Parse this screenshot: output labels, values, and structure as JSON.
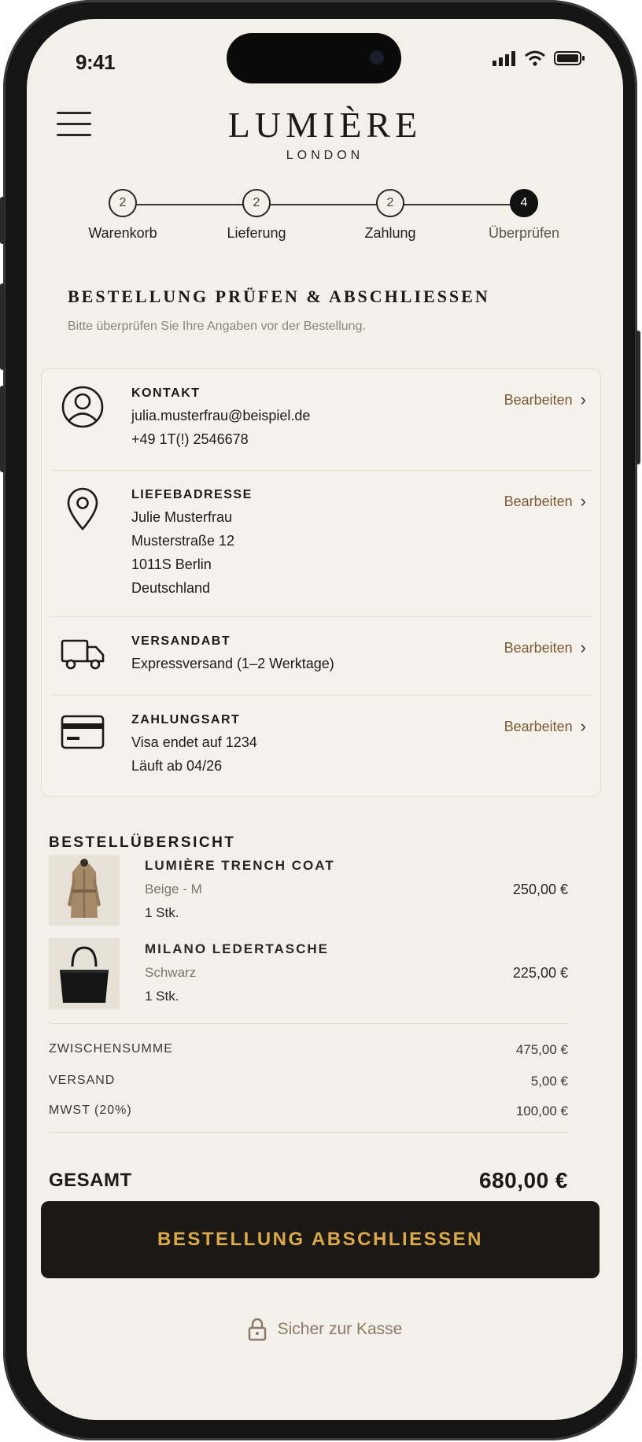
{
  "status_bar": {
    "time": "9:41"
  },
  "brand": {
    "name": "LUMIÈRE",
    "sub": "LONDON"
  },
  "steps": [
    {
      "number": "2",
      "label": "Warenkorb"
    },
    {
      "number": "2",
      "label": "Lieferung"
    },
    {
      "number": "2",
      "label": "Zahlung"
    },
    {
      "number": "4",
      "label": "Überprüfen"
    }
  ],
  "page": {
    "title": "BESTELLUNG PRÜFEN & ABSCHLIESSEN",
    "subtitle": "Bitte überprüfen Sie Ihre Angaben vor der Bestellung."
  },
  "review": {
    "edit_label": "Bearbeiten",
    "contact": {
      "label": "KONTAKT",
      "lines": [
        "julia.musterfrau@beispiel.de",
        "+49 1T(!) 2546678"
      ]
    },
    "address": {
      "label": "LIEFEBADRESSE",
      "lines": [
        "Julie Musterfrau",
        "Musterstraße 12",
        "1011S Berlin",
        "Deutschland"
      ]
    },
    "shipping": {
      "label": "VERSANDABT",
      "lines": [
        "Expressversand (1–2 Werktage)"
      ]
    },
    "payment": {
      "label": "ZAHLUNGSART",
      "lines": [
        "Visa endet auf 1234",
        "Läuft ab 04/26"
      ]
    }
  },
  "overview": {
    "title": "BESTELLÜBERSICHT",
    "items": [
      {
        "name": "LUMIÈRE TRENCH COAT",
        "variant": "Beige - M",
        "qty": "1 Stk.",
        "price": "250,00 €"
      },
      {
        "name": "MILANO LEDERTASCHE",
        "variant": "Schwarz",
        "qty": "1 Stk.",
        "price": "225,00 €"
      }
    ]
  },
  "summary": {
    "subtotal_label": "ZWISCHENSUMME",
    "subtotal": "475,00 €",
    "shipping_label": "VERSAND",
    "shipping": "5,00 €",
    "vat_label": "MWST (20%)",
    "vat": "100,00 €",
    "total_label": "GESAMT",
    "total": "680,00 €"
  },
  "checkout": {
    "button_label": "BESTELLUNG ABSCHLIESSEN",
    "secure_text": "Sicher zur Kasse"
  },
  "colors": {
    "background": "#f3efe9",
    "accent_gold": "#d9a94a",
    "edit_brown": "#7a5a38",
    "button_dark": "#1b1815"
  }
}
